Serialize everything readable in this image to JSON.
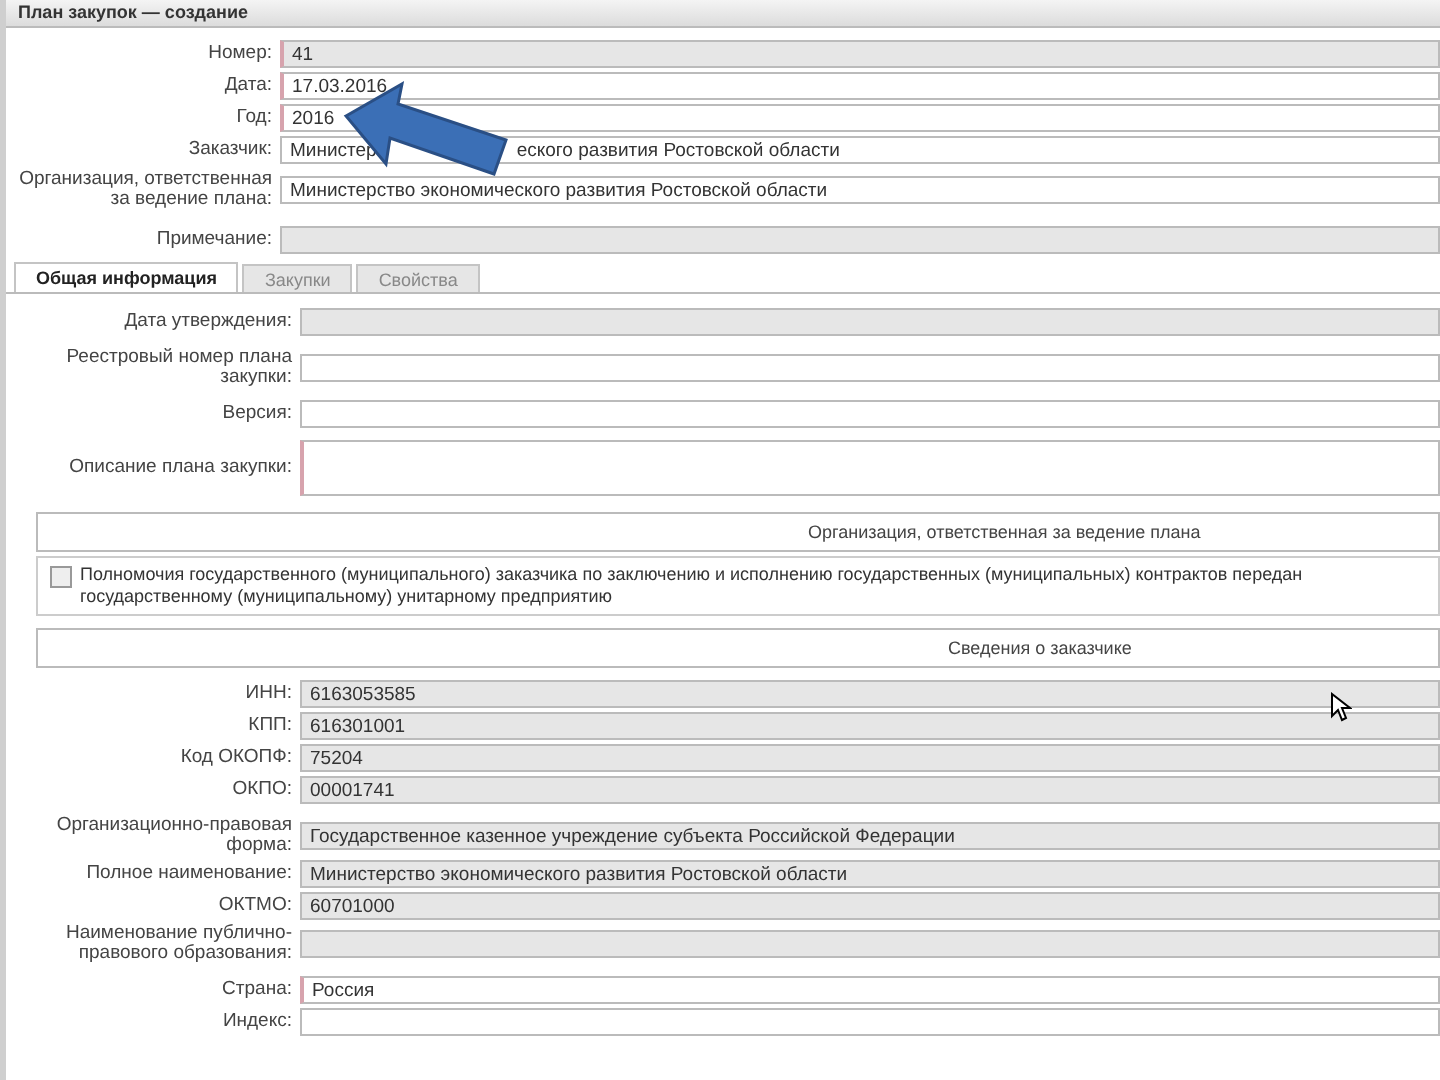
{
  "window": {
    "title": "План закупок — создание"
  },
  "header_fields": [
    {
      "label": "Номер:",
      "value": "41",
      "kind": "input",
      "required": true,
      "readonly": true
    },
    {
      "label": "Дата:",
      "value": "17.03.2016",
      "kind": "input",
      "required": true,
      "readonly": false
    },
    {
      "label": "Год:",
      "value": "2016",
      "kind": "input",
      "required": true,
      "readonly": false
    },
    {
      "label": "Заказчик:",
      "value_parts": [
        "Министер",
        "еского развития Ростовской области"
      ],
      "kind": "input",
      "required": false,
      "readonly": false
    },
    {
      "label": "Организация, ответственная за ведение плана:",
      "value": "Министерство экономического развития Ростовской области",
      "kind": "input",
      "required": false,
      "readonly": false
    },
    {
      "label": "Примечание:",
      "kind": "input",
      "required": false,
      "readonly": true
    }
  ],
  "tabs": [
    {
      "label": "Общая информация",
      "selected": true
    },
    {
      "label": "Закупки",
      "selected": false
    },
    {
      "label": "Свойства",
      "selected": false
    }
  ],
  "general_fields": [
    {
      "label": "Дата утверждения:",
      "kind": "input",
      "required": false,
      "readonly": true
    },
    {
      "label": "Реестровый номер плана закупки:",
      "kind": "input",
      "required": false,
      "readonly": false
    },
    {
      "label": "Версия:",
      "kind": "input",
      "required": false,
      "readonly": false
    },
    {
      "label": "Описание плана закупки:",
      "kind": "textarea",
      "required": true,
      "readonly": false
    }
  ],
  "responsible_section": {
    "title": "Организация, ответственная за ведение плана"
  },
  "delegation_checkbox": {
    "label": "Полномочия государственного (муниципального) заказчика по заключению и исполнению государственных (муниципальных) контрактов передан государственному (муниципальному) унитарному предприятию",
    "checked": false
  },
  "customer_section": {
    "title": "Сведения о заказчике"
  },
  "customer_fields": [
    {
      "label": "ИНН:",
      "value": "6163053585",
      "kind": "input",
      "required": false,
      "readonly": true
    },
    {
      "label": "КПП:",
      "value": "616301001",
      "kind": "input",
      "required": false,
      "readonly": true
    },
    {
      "label": "Код ОКОПФ:",
      "value": "75204",
      "kind": "input",
      "required": false,
      "readonly": true
    },
    {
      "label": "ОКПО:",
      "value": "00001741",
      "kind": "input",
      "required": false,
      "readonly": true
    },
    {
      "label": "Организационно-правовая форма:",
      "value": "Государственное казенное учреждение субъекта Российской Федерации",
      "kind": "input",
      "required": false,
      "readonly": true
    },
    {
      "label": "Полное наименование:",
      "value": "Министерство экономического развития Ростовской области",
      "kind": "input",
      "required": false,
      "readonly": true
    },
    {
      "label": "ОКТМО:",
      "value": "60701000",
      "kind": "input",
      "required": false,
      "readonly": true
    },
    {
      "label": "Наименование публично-правового образования:",
      "kind": "input",
      "required": false,
      "readonly": true
    },
    {
      "label": "Страна:",
      "value": "Россия",
      "kind": "input",
      "required": true,
      "readonly": false
    },
    {
      "label": "Индекс:",
      "kind": "input",
      "required": false,
      "readonly": false
    }
  ]
}
